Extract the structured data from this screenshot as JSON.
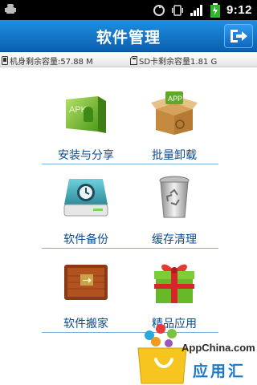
{
  "status_bar": {
    "time": "9:12"
  },
  "header": {
    "title": "软件管理",
    "exit_icon": "exit-icon"
  },
  "storage": {
    "phone_label": "机身剩余容量:57.88 M",
    "sd_label": "SD卡剩余容量1.81 G"
  },
  "tiles": [
    {
      "label": "安装与分享",
      "icon": "apk-install-icon",
      "icon_text": "APK"
    },
    {
      "label": "批量卸载",
      "icon": "app-box-icon",
      "icon_text": "APP"
    },
    {
      "label": "软件备份",
      "icon": "backup-drive-icon"
    },
    {
      "label": "缓存清理",
      "icon": "trash-icon"
    },
    {
      "label": "软件搬家",
      "icon": "move-box-icon"
    },
    {
      "label": "精品应用",
      "icon": "gift-icon"
    }
  ],
  "appchina": {
    "brand": "AppChina.com",
    "cn": "应用汇"
  }
}
